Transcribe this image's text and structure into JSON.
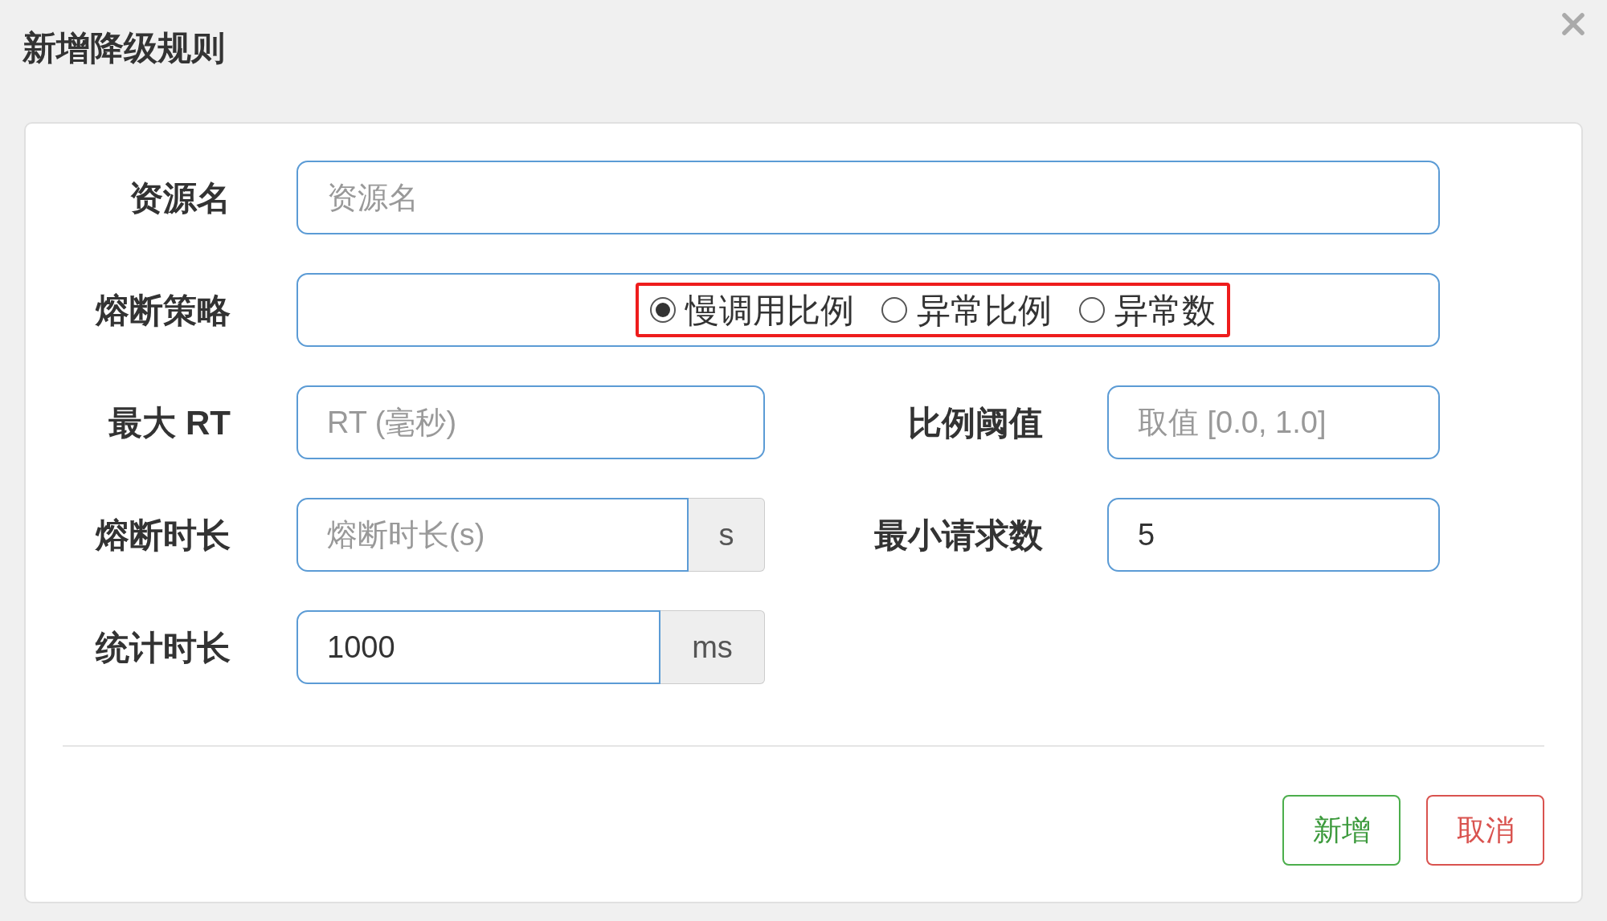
{
  "dialog": {
    "title": "新增降级规则"
  },
  "resource": {
    "label": "资源名",
    "placeholder": "资源名"
  },
  "strategy": {
    "label": "熔断策略",
    "options": [
      {
        "label": "慢调用比例",
        "selected": true
      },
      {
        "label": "异常比例",
        "selected": false
      },
      {
        "label": "异常数",
        "selected": false
      }
    ]
  },
  "rows": [
    {
      "left": {
        "label": "最大 RT",
        "placeholder": "RT (毫秒)"
      },
      "right": {
        "label": "比例阈值",
        "placeholder": "取值 [0.0, 1.0]"
      }
    },
    {
      "left": {
        "label": "熔断时长",
        "placeholder": "熔断时长(s)",
        "addon": "s"
      },
      "right": {
        "label": "最小请求数",
        "value": "5"
      }
    },
    {
      "left": {
        "label": "统计时长",
        "value": "1000",
        "addon": "ms"
      }
    }
  ],
  "buttons": [
    {
      "label": "新增",
      "kind": "primary"
    },
    {
      "label": "取消",
      "kind": "danger"
    }
  ]
}
